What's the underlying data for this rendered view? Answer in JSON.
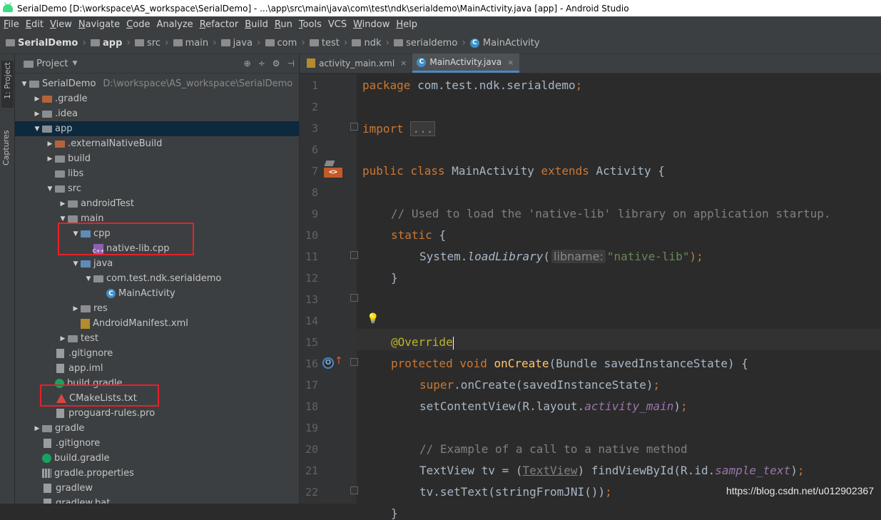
{
  "window": {
    "title": "SerialDemo [D:\\workspace\\AS_workspace\\SerialDemo] - ...\\app\\src\\main\\java\\com\\test\\ndk\\serialdemo\\MainActivity.java [app] - Android Studio"
  },
  "menu": [
    {
      "m": "F",
      "rest": "ile"
    },
    {
      "m": "E",
      "rest": "dit"
    },
    {
      "m": "V",
      "rest": "iew"
    },
    {
      "m": "N",
      "rest": "avigate"
    },
    {
      "m": "C",
      "rest": "ode"
    },
    {
      "m": "",
      "rest": "Analyze"
    },
    {
      "m": "R",
      "rest": "efactor"
    },
    {
      "m": "B",
      "rest": "uild"
    },
    {
      "m": "R",
      "rest": "un"
    },
    {
      "m": "T",
      "rest": "ools"
    },
    {
      "m": "",
      "rest": "VCS"
    },
    {
      "m": "W",
      "rest": "indow"
    },
    {
      "m": "H",
      "rest": "elp"
    }
  ],
  "breadcrumb": [
    "SerialDemo",
    "app",
    "src",
    "main",
    "java",
    "com",
    "test",
    "ndk",
    "serialdemo",
    "MainActivity"
  ],
  "side_tabs": {
    "project": "1: Project",
    "captures": "Captures"
  },
  "project_panel": {
    "title": "Project",
    "tools": [
      "⊕",
      "÷",
      "⚙",
      "⊣"
    ]
  },
  "tree": [
    {
      "label": "SerialDemo",
      "extra": "D:\\workspace\\AS_workspace\\SerialDemo",
      "arrow": "▼",
      "icon": "folder"
    },
    {
      "label": ".gradle",
      "arrow": "▶",
      "icon": "folder-orange"
    },
    {
      "label": ".idea",
      "arrow": "▶",
      "icon": "folder"
    },
    {
      "label": "app",
      "arrow": "▼",
      "icon": "folder"
    },
    {
      "label": ".externalNativeBuild",
      "arrow": "▶",
      "icon": "folder-orange"
    },
    {
      "label": "build",
      "arrow": "▶",
      "icon": "folder"
    },
    {
      "label": "libs",
      "arrow": "",
      "icon": "folder"
    },
    {
      "label": "src",
      "arrow": "▼",
      "icon": "folder"
    },
    {
      "label": "androidTest",
      "arrow": "▶",
      "icon": "folder"
    },
    {
      "label": "main",
      "arrow": "▼",
      "icon": "folder"
    },
    {
      "label": "cpp",
      "arrow": "▼",
      "icon": "folder-blue"
    },
    {
      "label": "native-lib.cpp",
      "arrow": "",
      "icon": "cpp"
    },
    {
      "label": "java",
      "arrow": "▼",
      "icon": "folder-blue"
    },
    {
      "label": "com.test.ndk.serialdemo",
      "arrow": "▼",
      "icon": "folder"
    },
    {
      "label": "MainActivity",
      "arrow": "",
      "icon": "class"
    },
    {
      "label": "res",
      "arrow": "▶",
      "icon": "folder"
    },
    {
      "label": "AndroidManifest.xml",
      "arrow": "",
      "icon": "xml"
    },
    {
      "label": "test",
      "arrow": "▶",
      "icon": "folder"
    },
    {
      "label": ".gitignore",
      "arrow": "",
      "icon": "file"
    },
    {
      "label": "app.iml",
      "arrow": "",
      "icon": "file"
    },
    {
      "label": "build.gradle",
      "arrow": "",
      "icon": "gradle"
    },
    {
      "label": "CMakeLists.txt",
      "arrow": "",
      "icon": "cmake"
    },
    {
      "label": "proguard-rules.pro",
      "arrow": "",
      "icon": "file"
    },
    {
      "label": "gradle",
      "arrow": "▶",
      "icon": "folder"
    },
    {
      "label": ".gitignore",
      "arrow": "",
      "icon": "file"
    },
    {
      "label": "build.gradle",
      "arrow": "",
      "icon": "gradle"
    },
    {
      "label": "gradle.properties",
      "arrow": "",
      "icon": "props"
    },
    {
      "label": "gradlew",
      "arrow": "",
      "icon": "file"
    },
    {
      "label": "gradlew.bat",
      "arrow": "",
      "icon": "file"
    }
  ],
  "tabs": [
    {
      "label": "activity_main.xml",
      "close": "×"
    },
    {
      "label": "MainActivity.java",
      "close": "×"
    }
  ],
  "line_numbers": [
    "1",
    "2",
    "3",
    "6",
    "7",
    "8",
    "9",
    "10",
    "11",
    "12",
    "13",
    "14",
    "15",
    "16",
    "17",
    "18",
    "19",
    "20",
    "21",
    "22"
  ],
  "code": {
    "l1a": "package ",
    "l1b": "com.test.ndk.serialdemo",
    "l1c": ";",
    "l3a": "import ",
    "l3b": "...",
    "l7a": "public class ",
    "l7b": "MainActivity ",
    "l7c": "extends ",
    "l7d": "Activity {",
    "l9": "// Used to load the 'native-lib' library on application startup.",
    "l10a": "static ",
    "l10b": "{",
    "l11a": "System.",
    "l11b": "loadLibrary",
    "l11c": "(",
    "l11hint": "libname:",
    "l11d": "\"native-lib\"",
    "l11e": ");",
    "l12": "}",
    "l14": "@Override",
    "l15a": "protected void ",
    "l15b": "onCreate",
    "l15c": "(Bundle savedInstanceState) {",
    "l16a": "super",
    "l16b": ".onCreate(savedInstanceState)",
    "l16c": ";",
    "l17a": "setContentView(R.layout.",
    "l17b": "activity_main",
    "l17c": ")",
    "l17d": ";",
    "l19": "// Example of a call to a native method",
    "l20a": "TextView tv = (",
    "l20b": "TextView",
    "l20c": ") findViewById(R.id.",
    "l20d": "sample_text",
    "l20e": ")",
    "l20f": ";",
    "l21a": "tv.setText(stringFromJNI())",
    "l21b": ";",
    "l22": "}"
  },
  "gutter_icons": {
    "class_icon": "<>",
    "override_icon": "O"
  },
  "watermark": "https://blog.csdn.net/u012902367"
}
